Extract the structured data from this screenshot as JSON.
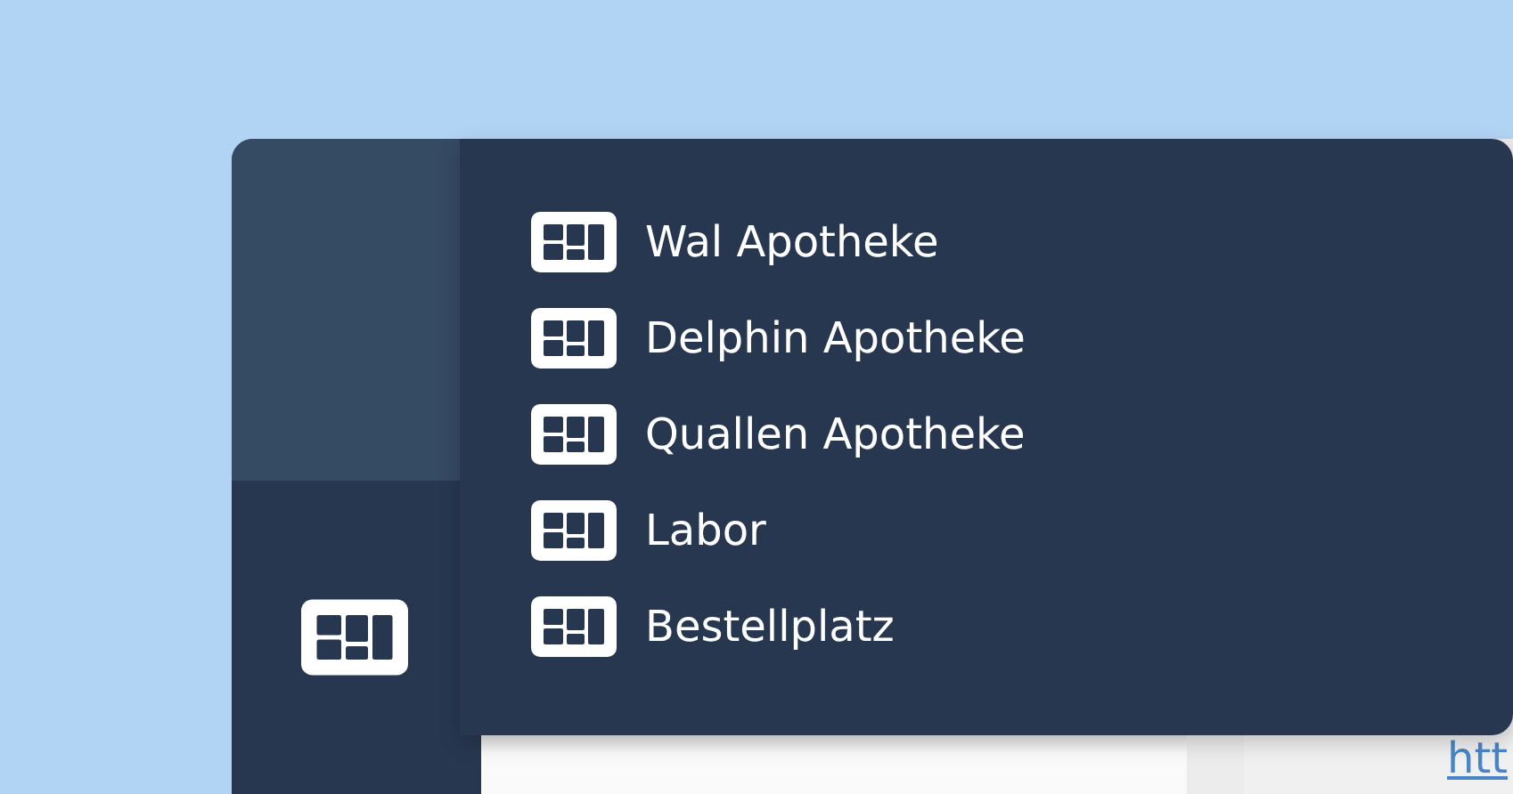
{
  "menu": {
    "items": [
      {
        "label": "Wal Apotheke"
      },
      {
        "label": "Delphin Apotheke"
      },
      {
        "label": "Quallen Apotheke"
      },
      {
        "label": "Labor"
      },
      {
        "label": "Bestellplatz"
      }
    ]
  },
  "content": {
    "link": "htt"
  }
}
